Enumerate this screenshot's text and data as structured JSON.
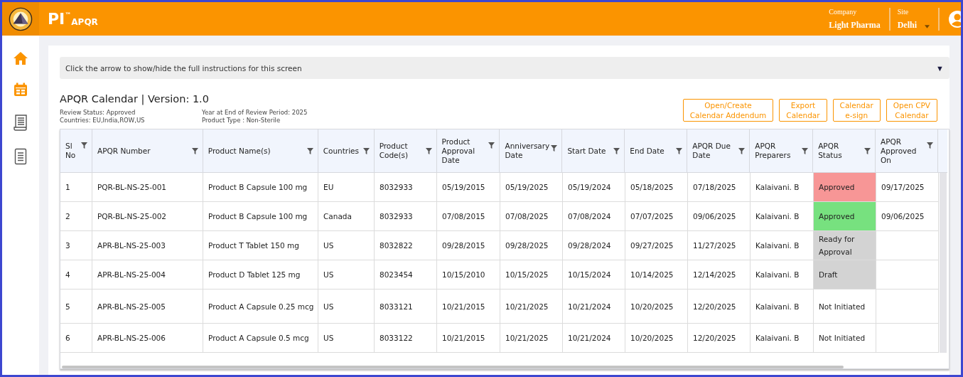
{
  "header": {
    "brand": "PI",
    "brand_mark": "™",
    "product": "APQR",
    "company_label": "Company",
    "company": "Light Pharma",
    "site_label": "Site",
    "site": "Delhi"
  },
  "sidebar": {
    "items": [
      {
        "kind": "home",
        "selected": true
      },
      {
        "kind": "calendar",
        "selected": true
      },
      {
        "kind": "scroll",
        "selected": false
      },
      {
        "kind": "document",
        "selected": false
      }
    ]
  },
  "instructions": {
    "text": "Click the arrow to show/hide the full instructions for this screen",
    "toggle": "▼"
  },
  "title": "APQR Calendar | Version: 1.0",
  "meta": [
    "Review Status: Approved",
    "Countries: EU,India,ROW,US",
    "Year at End of Review Period: 2025",
    "Product Type : Non-Sterile"
  ],
  "buttons": [
    [
      "Open/Create",
      "Calendar Addendum"
    ],
    [
      "Export",
      "Calendar"
    ],
    [
      "Calendar",
      "e-sign"
    ],
    [
      "Open CPV",
      "Calendar"
    ]
  ],
  "table": {
    "columns": [
      "Sl No",
      "APQR Number",
      "Product Name(s)",
      "Countries",
      "Product Code(s)",
      "Product Approval Date",
      "Anniversary Date",
      "Start Date",
      "End Date",
      "APQR Due Date",
      "APQR Preparers",
      "APQR Status",
      "APQR Approved On"
    ],
    "rows": [
      {
        "cells": [
          "1",
          "PQR-BL-NS-25-001",
          "Product B Capsule 100 mg",
          "EU",
          "8032933",
          "05/19/2015",
          "05/19/2025",
          "05/19/2024",
          "05/18/2025",
          "07/18/2025",
          "Kalaivani. B"
        ],
        "status": [
          "Approved"
        ],
        "color": "#f79696",
        "approved_on": "09/17/2025"
      },
      {
        "cells": [
          "2",
          "PQR-BL-NS-25-002",
          "Product B Capsule 100 mg",
          "Canada",
          "8032933",
          "07/08/2015",
          "07/08/2025",
          "07/08/2024",
          "07/07/2025",
          "09/06/2025",
          "Kalaivani. B"
        ],
        "status": [
          "Approved"
        ],
        "color": "#77e17f",
        "approved_on": "09/06/2025"
      },
      {
        "cells": [
          "3",
          "APR-BL-NS-25-003",
          "Product T Tablet 150 mg",
          "US",
          "8032822",
          "09/28/2015",
          "09/28/2025",
          "09/28/2024",
          "09/27/2025",
          "11/27/2025",
          "Kalaivani. B"
        ],
        "status": [
          "Ready for",
          "Approval"
        ],
        "color": "#d3d3d3"
      },
      {
        "cells": [
          "4",
          "APR-BL-NS-25-004",
          "Product D Tablet 125 mg",
          "US",
          "8023454",
          "10/15/2010",
          "10/15/2025",
          "10/15/2024",
          "10/14/2025",
          "12/14/2025",
          "Kalaivani. B"
        ],
        "status": [
          "Draft"
        ],
        "color": "#d3d3d3"
      },
      {
        "cells": [
          "5",
          "APR-BL-NS-25-005",
          "Product A Capsule 0.25 mcg",
          "US",
          "8033121",
          "10/21/2015",
          "10/21/2025",
          "10/21/2024",
          "10/20/2025",
          "12/20/2025",
          "Kalaivani. B"
        ],
        "status": [
          "Not Initiated"
        ],
        "color": "#ffffff"
      },
      {
        "cells": [
          "6",
          "APR-BL-NS-25-006",
          "Product A Capsule 0.5 mcg",
          "US",
          "8033122",
          "10/21/2015",
          "10/21/2025",
          "10/21/2024",
          "10/20/2025",
          "12/20/2025",
          "Kalaivani. B"
        ],
        "status": [
          "Not Initiated"
        ],
        "color": "#ffffff"
      }
    ]
  }
}
